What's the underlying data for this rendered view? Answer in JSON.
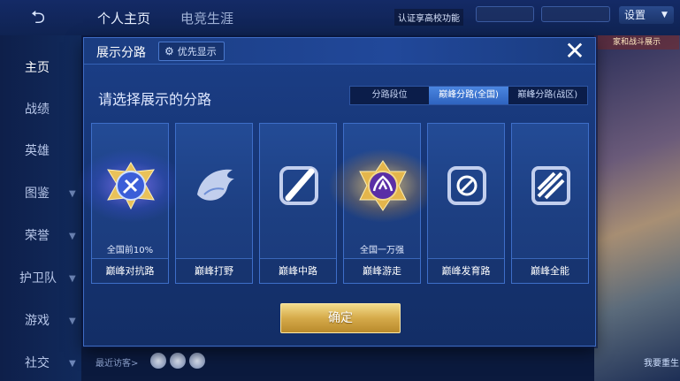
{
  "background": {
    "top_tabs": [
      "个人主页",
      "电竞生涯"
    ],
    "notice": "认证享高校功能",
    "settings_label": "设置",
    "sidebar": [
      "主页",
      "战绩",
      "英雄",
      "图鉴",
      "荣誉",
      "护卫队",
      "游戏",
      "社交"
    ],
    "recent_visitors": "最近访客>",
    "right_badge": "家和战斗展示",
    "right_label": "我要重生"
  },
  "modal": {
    "title": "展示分路",
    "priority_label": "优先显示",
    "prompt": "请选择展示的分路",
    "tabs": [
      "分路段位",
      "巅峰分路(全国)",
      "巅峰分路(战区)"
    ],
    "active_tab": 1,
    "roles": [
      {
        "name": "巅峰对抗路",
        "sub": "全国前10%",
        "icon": "clash-lane-icon",
        "highlight": "blue"
      },
      {
        "name": "巅峰打野",
        "sub": "",
        "icon": "jungle-icon",
        "highlight": ""
      },
      {
        "name": "巅峰中路",
        "sub": "",
        "icon": "mid-lane-icon",
        "highlight": ""
      },
      {
        "name": "巅峰游走",
        "sub": "全国一万强",
        "icon": "roam-icon",
        "highlight": "gold"
      },
      {
        "name": "巅峰发育路",
        "sub": "",
        "icon": "farm-lane-icon",
        "highlight": ""
      },
      {
        "name": "巅峰全能",
        "sub": "",
        "icon": "all-round-icon",
        "highlight": ""
      }
    ],
    "confirm_label": "确定"
  },
  "colors": {
    "modal_bg": "#163575",
    "accent_blue": "#2e63bf",
    "gold": "#d5aa4a"
  }
}
